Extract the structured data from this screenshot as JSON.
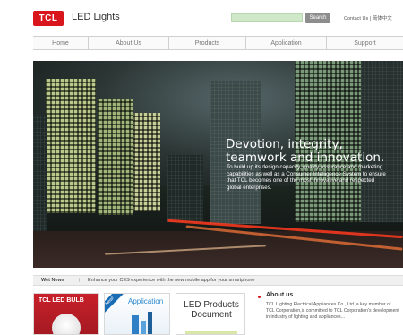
{
  "header": {
    "logo_text": "TCL",
    "brand": "LED Lights",
    "search_button": "Search",
    "top_links": "Contact Us | 简体中文"
  },
  "nav": {
    "items": [
      {
        "label": "Home"
      },
      {
        "label": "About Us"
      },
      {
        "label": "Products"
      },
      {
        "label": "Application"
      },
      {
        "label": "Support"
      }
    ]
  },
  "hero": {
    "headline": "Devotion, integrity, teamwork and innovation.",
    "body": "To build up its design capacity, quality assurance and marketing capabilities as well as a Consumer Intelligence System to ensure that TCL becomes one of the most innovative and respected global enterprises."
  },
  "news": {
    "label": "Wet News",
    "separator": "|",
    "text": "Enhance your CES experience with the new mobile app for your smartphone"
  },
  "cards": {
    "bulb_title": "TCL LED BULB",
    "app_ribbon": "New!",
    "app_title": "Application",
    "doc_title": "LED Products Document"
  },
  "about": {
    "title": "About us",
    "text": "TCL Lighting Electrical Appliances Co., Ltd.,a key member of TCL Corporation,is committed to TCL Corporation's development in industry of lighting and appliances..."
  },
  "colors": {
    "brand_red": "#d9161c",
    "search_green": "#cfe8c8",
    "app_blue": "#2b87cf"
  }
}
